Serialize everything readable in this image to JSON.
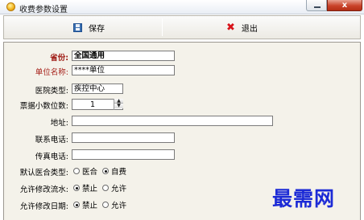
{
  "window": {
    "title": "收费参数设置",
    "close_glyph": "x"
  },
  "toolbar": {
    "save_label": "保存",
    "exit_label": "退出"
  },
  "form": {
    "province": {
      "label": "省份:",
      "value": "全国通用"
    },
    "unit_name": {
      "label": "单位名称:",
      "value": "****单位"
    },
    "hospital_type": {
      "label": "医院类型:",
      "value": "疾控中心"
    },
    "decimal_places": {
      "label": "票据小数位数:",
      "value": "1"
    },
    "address": {
      "label": "地址:",
      "value": ""
    },
    "phone": {
      "label": "联系电话:",
      "value": ""
    },
    "fax": {
      "label": "传真电话:",
      "value": ""
    },
    "default_insurance_type": {
      "label": "默认医合类型:",
      "options": [
        "医合",
        "自费"
      ],
      "selected": "自费"
    },
    "allow_modify_serial": {
      "label": "允许修改流水:",
      "options": [
        "禁止",
        "允许"
      ],
      "selected": "禁止"
    },
    "allow_modify_date": {
      "label": "允许修改日期:",
      "options": [
        "禁止",
        "允许"
      ],
      "selected": "禁止"
    }
  },
  "watermark": "最需网"
}
